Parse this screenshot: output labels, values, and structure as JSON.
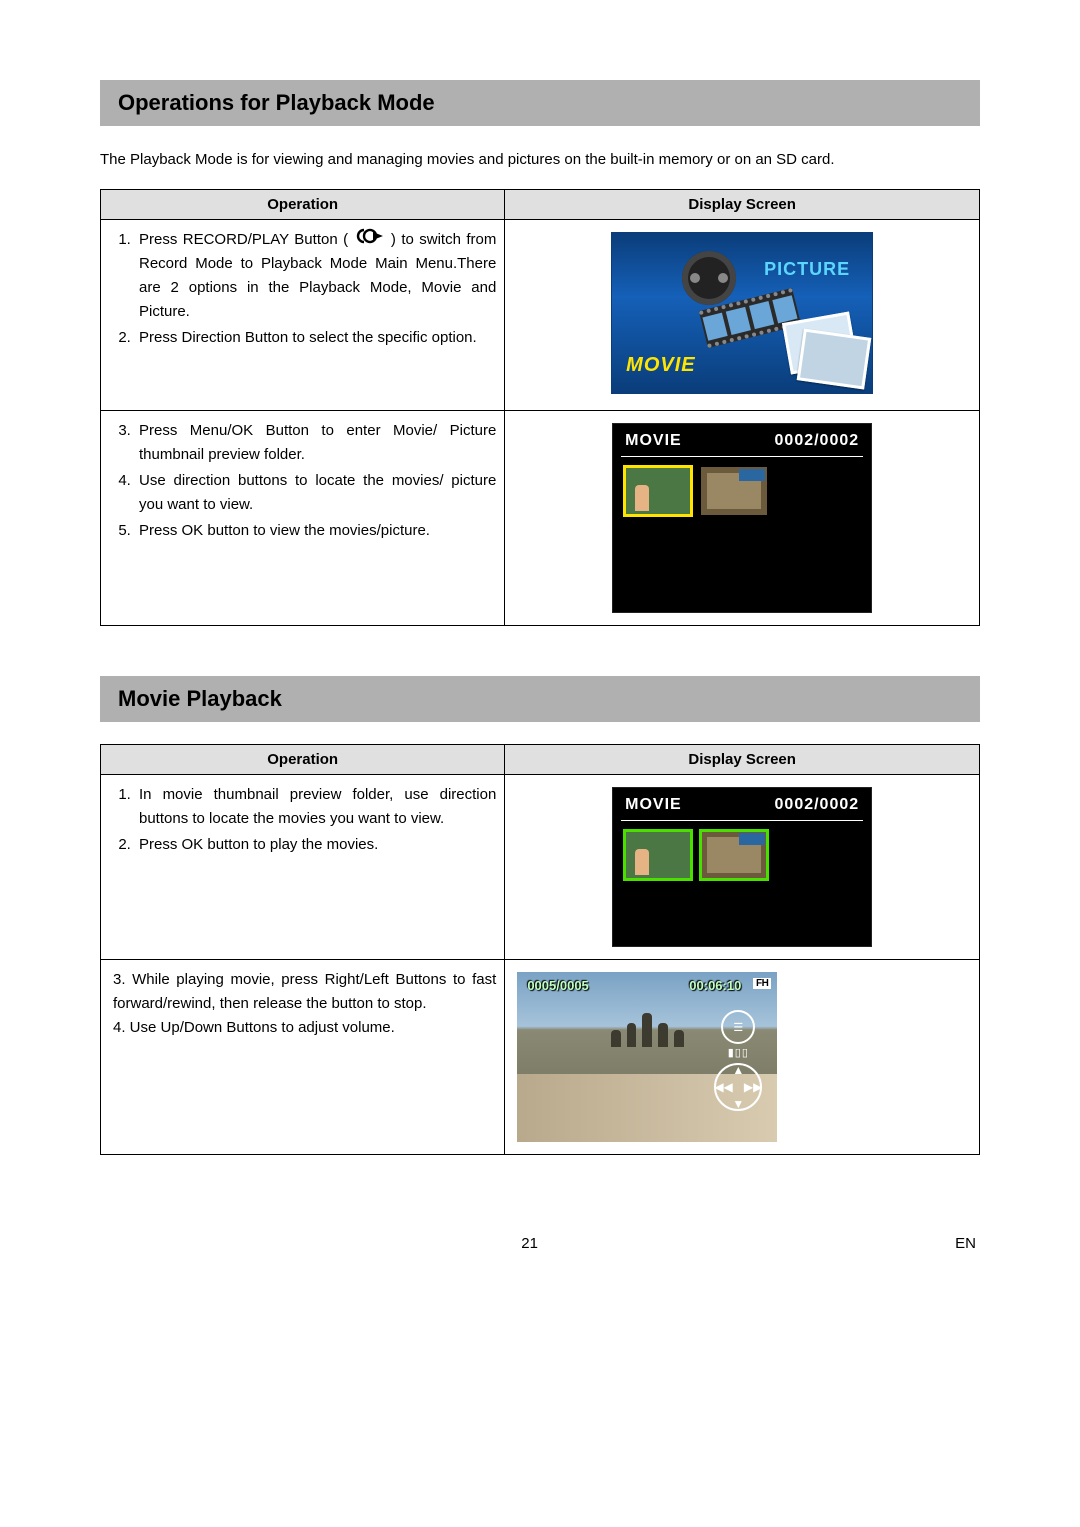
{
  "section1": {
    "heading": "Operations for Playback Mode",
    "intro": "The Playback Mode is for viewing and managing movies and pictures on the built-in memory or on an SD card.",
    "col_op": "Operation",
    "col_screen": "Display Screen",
    "row1": {
      "step1a": "Press RECORD/PLAY Button (",
      "step1b": ") to switch from Record Mode to Playback Mode Main Menu.There are 2 options in the Playback Mode, Movie and Picture.",
      "step2": "Press Direction Button to select the specific option.",
      "screen": {
        "picture_label": "PICTURE",
        "movie_label": "MOVIE"
      }
    },
    "row2": {
      "step3": "Press Menu/OK Button to enter Movie/ Picture thumbnail preview folder.",
      "step4": "Use direction buttons to locate the movies/ picture you want to view.",
      "step5": "Press OK button to view the movies/picture.",
      "screen": {
        "title": "MOVIE",
        "counter": "0002/0002"
      }
    }
  },
  "section2": {
    "heading": "Movie Playback",
    "col_op": "Operation",
    "col_screen": "Display Screen",
    "row1": {
      "step1": "In movie thumbnail preview folder, use direction buttons to locate the movies you want to view.",
      "step2": "Press OK button to play the movies.",
      "screen": {
        "title": "MOVIE",
        "counter": "0002/0002"
      }
    },
    "row2": {
      "step3": "3. While playing movie, press Right/Left Buttons to fast forward/rewind, then release the button to stop.",
      "step4": "4. Use Up/Down Buttons to adjust volume.",
      "screen": {
        "counter": "0005/0005",
        "time": "00:06:10",
        "badge": "FH"
      }
    }
  },
  "footer": {
    "page": "21",
    "lang": "EN"
  }
}
